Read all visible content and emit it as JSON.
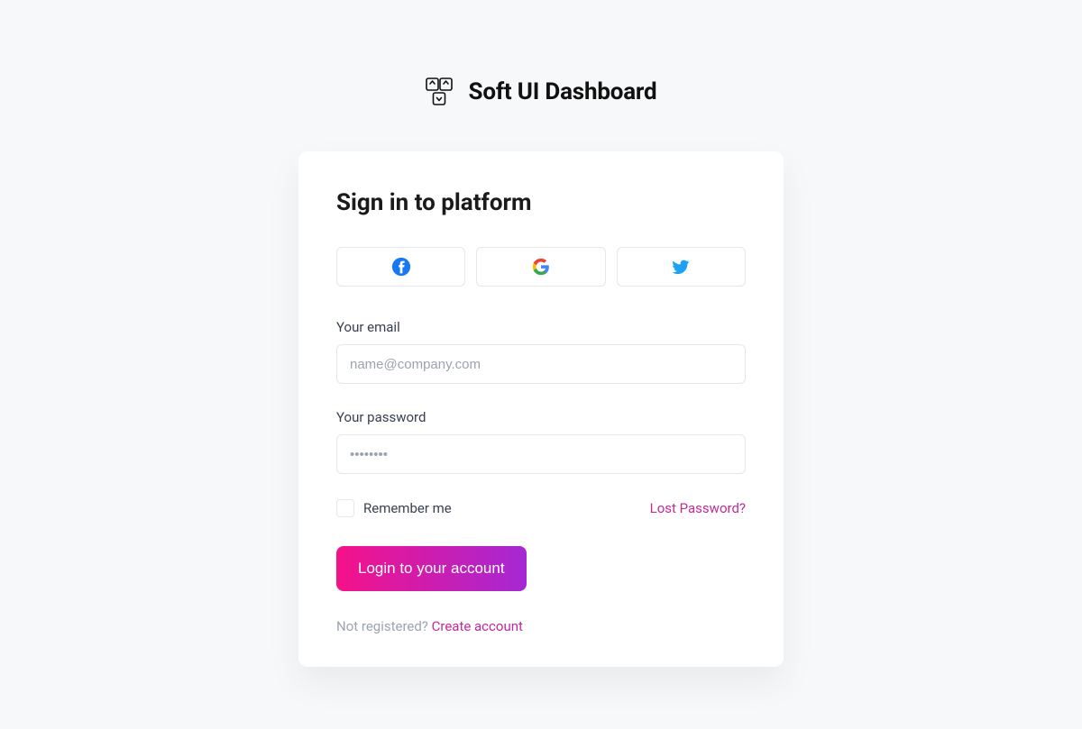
{
  "brand": {
    "title": "Soft UI Dashboard"
  },
  "card": {
    "title": "Sign in to platform",
    "email_label": "Your email",
    "email_placeholder": "name@company.com",
    "password_label": "Your password",
    "password_placeholder": "••••••••",
    "remember_label": "Remember me",
    "lost_password": "Lost Password?",
    "login_button": "Login to your account",
    "not_registered": "Not registered? ",
    "create_account": "Create account"
  },
  "social": {
    "facebook": "facebook",
    "google": "google",
    "twitter": "twitter"
  }
}
